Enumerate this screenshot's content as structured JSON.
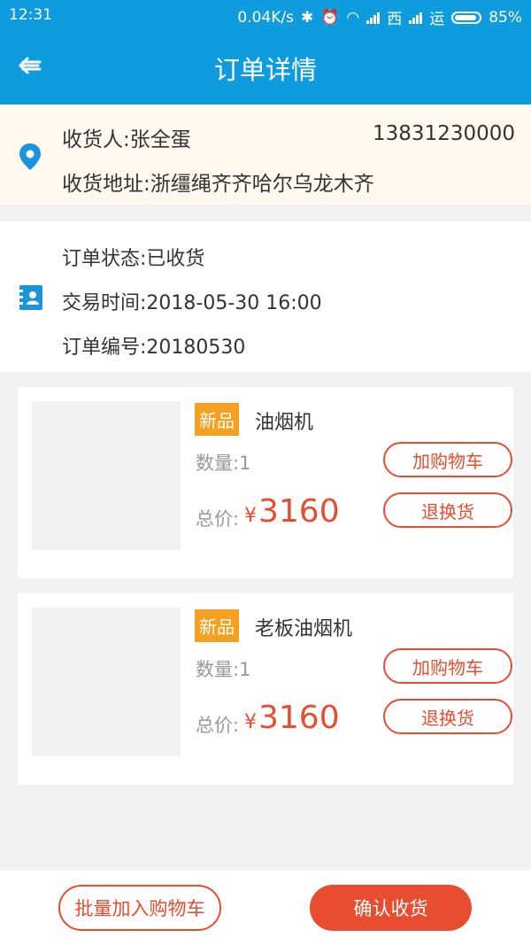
{
  "status_bar": {
    "time": "12:31",
    "speed": "0.04K/s",
    "carrier1": "西",
    "carrier2": "运",
    "battery": "85%"
  },
  "navbar": {
    "title": "订单详情",
    "back_icon": "back-arrow-icon"
  },
  "address": {
    "receiver": "收货人:张全蛋",
    "phone": "13831230000",
    "address": "收货地址:浙缰绳齐齐哈尔乌龙木齐",
    "icon": "location-pin-icon"
  },
  "order_info": {
    "status": "订单状态:已收货",
    "time": "交易时间:2018-05-30 16:00",
    "number": "订单编号:20180530",
    "icon": "contact-card-icon"
  },
  "items": [
    {
      "badge": "新品",
      "name": "油烟机",
      "qty": "数量:1",
      "price_label": "总价:",
      "currency": "¥",
      "price": "3160",
      "add_cart": "加购物车",
      "return": "退换货"
    },
    {
      "badge": "新品",
      "name": "老板油烟机",
      "qty": "数量:1",
      "price_label": "总价:",
      "currency": "¥",
      "price": "3160",
      "add_cart": "加购物车",
      "return": "退换货"
    }
  ],
  "bottom": {
    "batch_add": "批量加入购物车",
    "confirm": "确认收货"
  },
  "colors": {
    "primary": "#0e9cdf",
    "accent": "#e94d2f",
    "badge": "#f5a020",
    "address_bg": "#fff9f0"
  }
}
